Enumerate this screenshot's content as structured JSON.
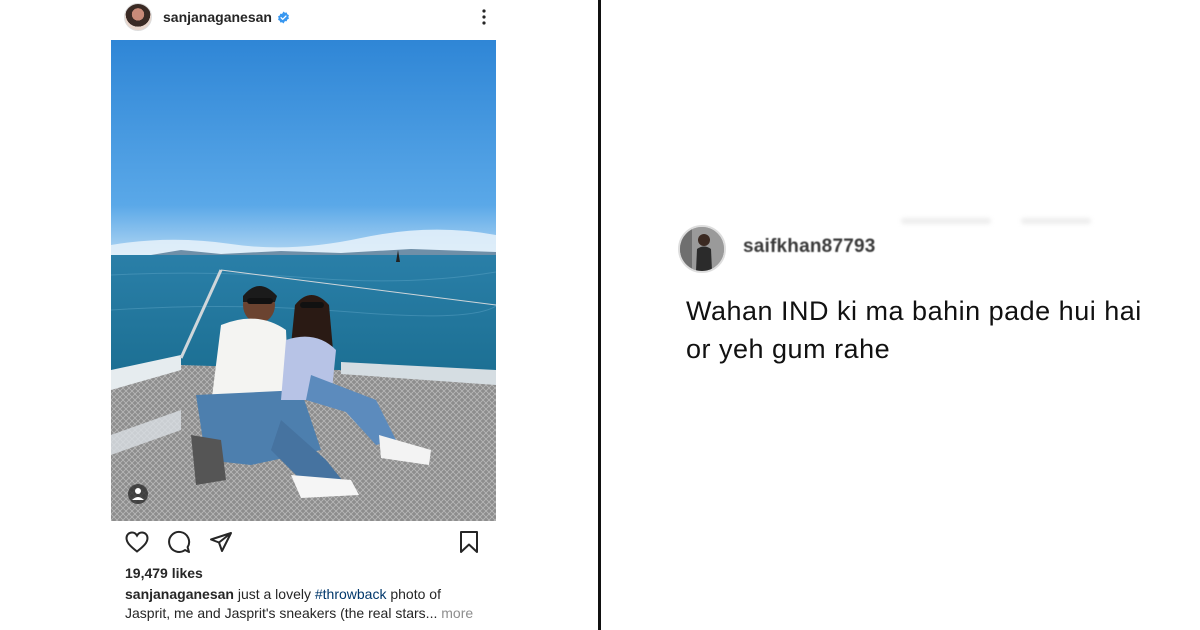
{
  "post": {
    "username": "sanjanaganesan",
    "likes": "19,479 likes",
    "caption": {
      "username": "sanjanaganesan",
      "text_before_tag": " just a lovely ",
      "hashtag": "#throwback",
      "text_after_tag": " photo of",
      "line2": "Jasprit, me and Jasprit's sneakers (the real stars...",
      "more_label": " more"
    }
  },
  "comment": {
    "username": "saifkhan87793",
    "text": "Wahan IND ki ma bahin pade hui hai or yeh gum rahe"
  },
  "colors": {
    "divider": "#111111",
    "verified_badge": "#3897f0",
    "hashtag": "#00376b",
    "muted": "#8e8e8e",
    "sky": "#3d8fd8",
    "sea": "#1f6f9a"
  },
  "icons": [
    "verified-badge-icon",
    "more-options-icon",
    "like-heart-icon",
    "comment-bubble-icon",
    "share-send-icon",
    "bookmark-save-icon",
    "user-tag-icon"
  ]
}
